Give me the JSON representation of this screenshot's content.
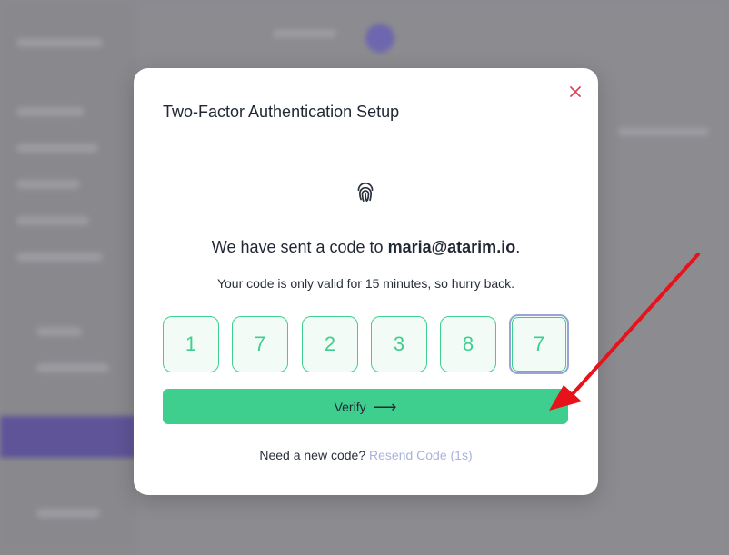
{
  "modal": {
    "title": "Two-Factor Authentication Setup",
    "close_icon": "close-icon",
    "fingerprint_icon": "fingerprint-icon",
    "sent_prefix": "We have sent a code to ",
    "sent_email": "maria@atarim.io",
    "sent_suffix": ".",
    "validity_text": "Your code is only valid for 15 minutes, so hurry back.",
    "code_digits": [
      "1",
      "7",
      "2",
      "3",
      "8",
      "7"
    ],
    "verify_label": "Verify",
    "verify_arrow": "⟶",
    "resend_prompt": "Need a new code?",
    "resend_link": "Resend Code (1s)"
  },
  "colors": {
    "accent_green": "#3ecf8e",
    "close_red": "#d9465c",
    "resend_link": "#a9b2dd",
    "annotation_arrow": "#e8121b"
  }
}
